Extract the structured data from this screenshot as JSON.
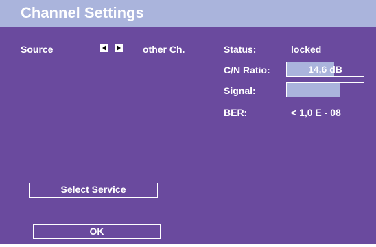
{
  "window": {
    "title": "Channel Settings"
  },
  "source": {
    "label": "Source",
    "value": "other Ch.",
    "prev_icon": "triangle-left-icon",
    "next_icon": "triangle-right-icon"
  },
  "status": {
    "label": "Status:",
    "value": "locked"
  },
  "cn_ratio": {
    "label": "C/N Ratio:",
    "value": "14,6 dB",
    "level_percent": 62
  },
  "signal": {
    "label": "Signal:",
    "level_percent": 70
  },
  "ber": {
    "label": "BER:",
    "value": "< 1,0 E - 08"
  },
  "buttons": {
    "select_service": "Select Service",
    "ok": "OK"
  },
  "colors": {
    "background": "#6a4a9e",
    "title_bar": "#aab4dc",
    "meter_fill": "#aab4dc"
  }
}
